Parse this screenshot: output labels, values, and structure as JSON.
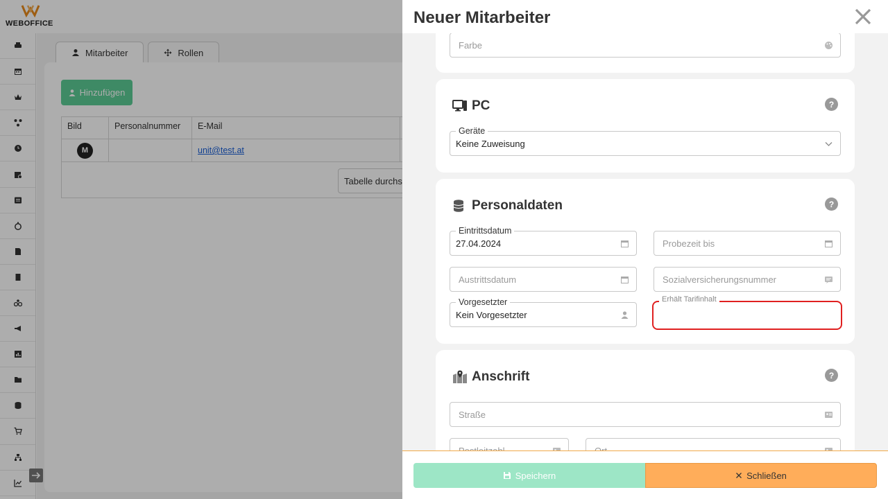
{
  "app": {
    "logo_text": "WEBOFFICE"
  },
  "sidebar": {
    "icons": [
      "printer-icon",
      "calendar-icon",
      "crown-icon",
      "network-icon",
      "clock-icon",
      "calendar-user-icon",
      "list-icon",
      "stopwatch-icon",
      "document-icon",
      "file-icon",
      "bicycle-icon",
      "megaphone-icon",
      "chart-icon",
      "folder-icon",
      "database-icon",
      "cart-icon",
      "workflow-icon",
      "analytics-icon"
    ]
  },
  "tabs": [
    {
      "label": "Mitarbeiter",
      "icon": "user-icon"
    },
    {
      "label": "Rollen",
      "icon": "move-icon"
    }
  ],
  "toolbar": {
    "add_label": "Hinzufügen"
  },
  "table": {
    "columns": [
      "Bild",
      "Personalnummer",
      "E-Mail"
    ],
    "rows": [
      {
        "avatar": "M",
        "personalnummer": "",
        "email": "unit@test.at"
      }
    ],
    "search_label": "Tabelle durchs"
  },
  "drawer": {
    "title": "Neuer Mitarbeiter",
    "farbe_placeholder": "Farbe",
    "pc": {
      "heading": "PC",
      "help": "?",
      "geraete_label": "Geräte",
      "geraete_value": "Keine Zuweisung"
    },
    "personal": {
      "heading": "Personaldaten",
      "help": "?",
      "eintritt_label": "Eintrittsdatum",
      "eintritt_value": "27.04.2024",
      "probezeit_placeholder": "Probezeit bis",
      "austritt_placeholder": "Austrittsdatum",
      "svnr_placeholder": "Sozialversicherungsnummer",
      "vorgesetzter_label": "Vorgesetzter",
      "vorgesetzter_value": "Kein Vorgesetzter",
      "error_field_label": "Erhält Tarifinhalt"
    },
    "address": {
      "heading": "Anschrift",
      "help": "?",
      "strasse_placeholder": "Straße",
      "plz_placeholder": "Postleitzahl",
      "ort_placeholder": "Ort"
    },
    "footer": {
      "save_label": "Speichern",
      "close_label": "Schließen"
    }
  },
  "colors": {
    "accent_green": "#5ccc95",
    "save_disabled": "#9de6c6",
    "close_orange": "#ffad5a",
    "error_red": "#e02020"
  }
}
